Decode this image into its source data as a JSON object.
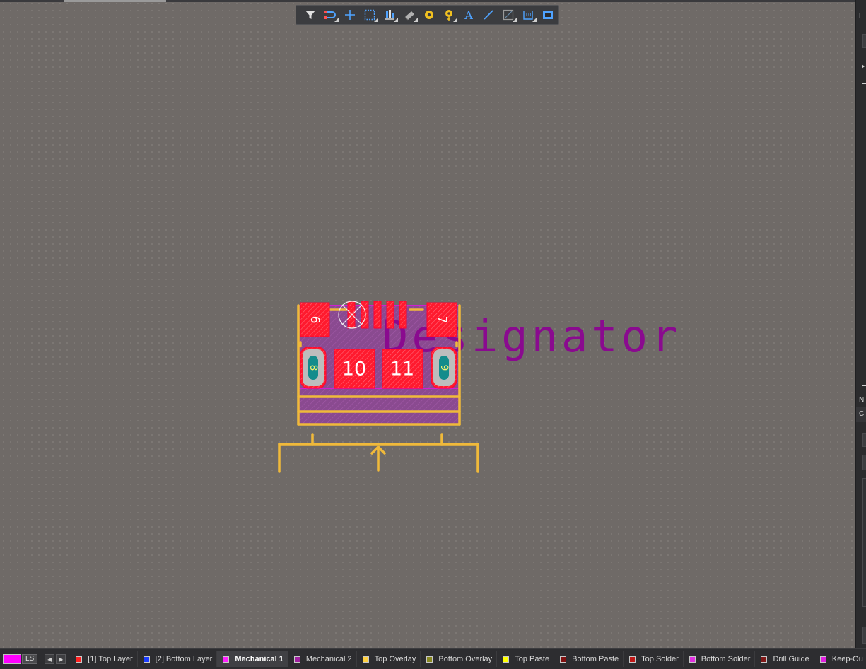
{
  "toolbar": {
    "icons": [
      "filter-icon",
      "route-icon",
      "cross-icon",
      "select-rect-icon",
      "align-icon",
      "component-icon",
      "pad-icon",
      "via-icon",
      "text-icon",
      "line-icon",
      "graph-icon",
      "dimension-icon",
      "region-icon"
    ]
  },
  "footprint": {
    "pads": [
      "6",
      "7",
      "8",
      "9",
      "10",
      "11"
    ],
    "designator_text": "Designator"
  },
  "status_bar": {
    "ls_label": "LS",
    "ls_color": "#ff00ff",
    "layers": [
      {
        "label": "[1] Top Layer",
        "color": "#ff2020"
      },
      {
        "label": "[2] Bottom Layer",
        "color": "#1a3cff"
      },
      {
        "label": "Mechanical 1",
        "color": "#ff20ff",
        "active": true
      },
      {
        "label": "Mechanical 2",
        "color": "#a020a0"
      },
      {
        "label": "Top Overlay",
        "color": "#ffd040"
      },
      {
        "label": "Bottom Overlay",
        "color": "#888820"
      },
      {
        "label": "Top Paste",
        "color": "#ffff00"
      },
      {
        "label": "Bottom Paste",
        "color": "#801010"
      },
      {
        "label": "Top Solder",
        "color": "#c01818"
      },
      {
        "label": "Bottom Solder",
        "color": "#e030e0"
      },
      {
        "label": "Drill Guide",
        "color": "#801818"
      },
      {
        "label": "Keep-Ou",
        "color": "#e020e0"
      }
    ]
  },
  "right_panel": {
    "texts": [
      "L",
      "N",
      "C"
    ]
  }
}
